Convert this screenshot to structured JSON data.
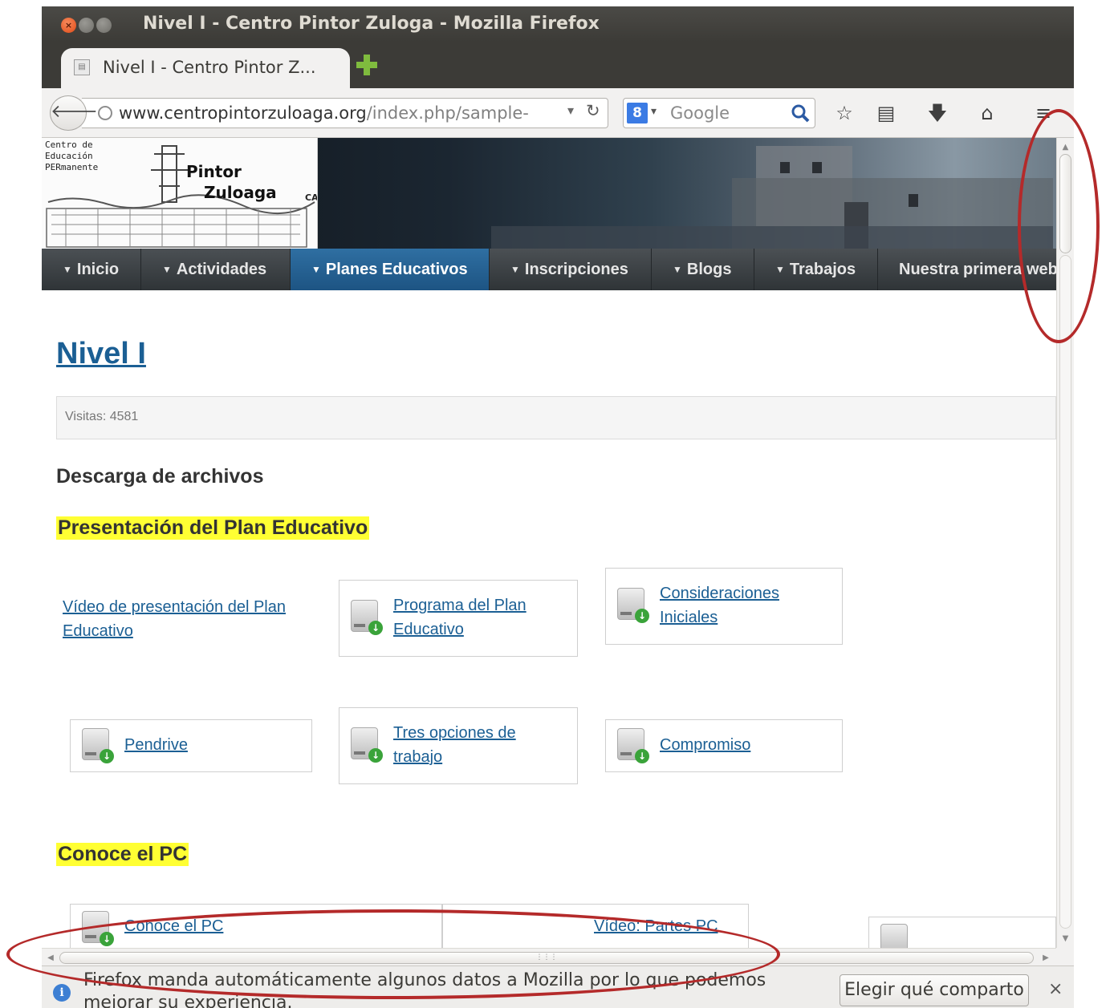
{
  "window": {
    "title": "Nivel I - Centro Pintor Zuloga - Mozilla Firefox",
    "close_glyph": "×"
  },
  "tab": {
    "title": "Nivel I - Centro Pintor Z..."
  },
  "navbar": {
    "url_host": "www.centropintorzuloaga.org",
    "url_path": "/index.php/sample-",
    "search_engine_glyph": "8",
    "search_placeholder": "Google"
  },
  "site": {
    "logo_line1": "Centro de",
    "logo_line2": "Educación",
    "logo_line3": "PERmanente",
    "logo_pintor": "Pintor",
    "logo_zuloaga": "Zuloaga",
    "logo_cadiz": "CADIZ",
    "menu": [
      {
        "label": "Inicio",
        "active": false
      },
      {
        "label": "Actividades",
        "active": false
      },
      {
        "label": "Planes Educativos",
        "active": true
      },
      {
        "label": "Inscripciones",
        "active": false
      },
      {
        "label": "Blogs",
        "active": false
      },
      {
        "label": "Trabajos",
        "active": false
      },
      {
        "label": "Nuestra primera web",
        "active": false
      }
    ]
  },
  "article": {
    "heading": "Nivel I",
    "hits": "Visitas: 4581",
    "downloads_title": "Descarga de archivos",
    "section1": "Presentación del Plan Educativo",
    "section2": "Conoce el PC",
    "links": {
      "video_plan": "Vídeo de presentación del Plan Educativo",
      "programa": "Programa del Plan Educativo",
      "consideraciones": "Consideraciones Iniciales",
      "pendrive": "Pendrive",
      "tres_opciones": "Tres opciones de trabajo",
      "compromiso": "Compromiso",
      "conoce_pc": "Conoce el PC",
      "video_partes": "Vídeo: Partes PC"
    }
  },
  "notification": {
    "text": "Firefox manda automáticamente algunos datos a Mozilla por lo que podemos mejorar su experiencia.",
    "button": "Elegir qué comparto",
    "close": "×"
  },
  "colors": {
    "annotation": "#b42a2a",
    "link": "#1b5f94",
    "highlight": "#ffff33",
    "nav_active": "#2f6fa2"
  }
}
